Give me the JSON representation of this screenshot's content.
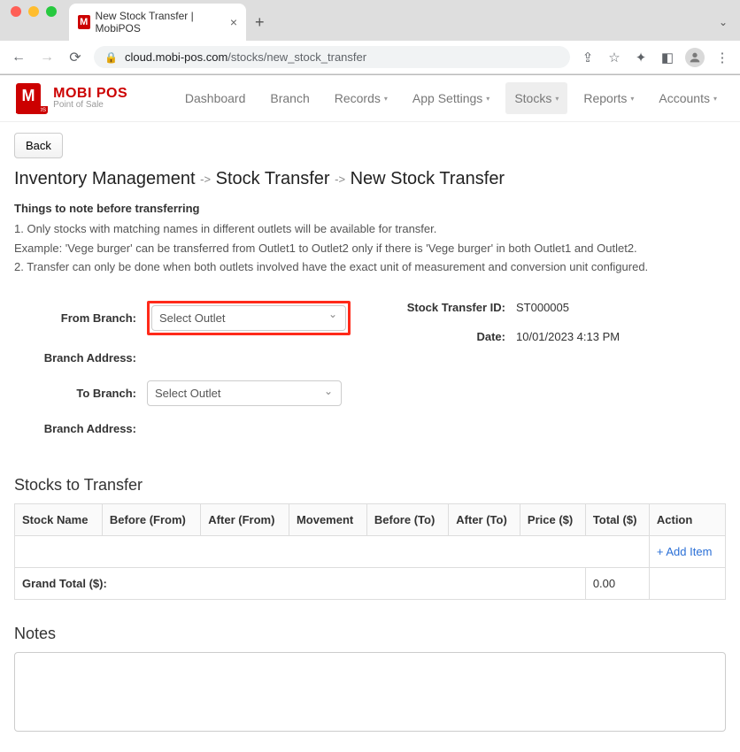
{
  "browser": {
    "tab_title": "New Stock Transfer | MobiPOS",
    "url_host": "cloud.mobi-pos.com",
    "url_path": "/stocks/new_stock_transfer"
  },
  "brand": {
    "logo_letter": "M",
    "logo_sub": "MOBI POS",
    "name": "MOBI POS",
    "tagline": "Point of Sale"
  },
  "nav": {
    "dashboard": "Dashboard",
    "branch": "Branch",
    "records": "Records",
    "app_settings": "App Settings",
    "stocks": "Stocks",
    "reports": "Reports",
    "accounts": "Accounts"
  },
  "back_label": "Back",
  "breadcrumb": {
    "a": "Inventory Management",
    "b": "Stock Transfer",
    "c": "New Stock Transfer"
  },
  "notes": {
    "heading": "Things to note before transferring",
    "n1": "1. Only stocks with matching names in different outlets will be available for transfer.",
    "n1b": "Example: 'Vege burger' can be transferred from Outlet1 to Outlet2 only if there is 'Vege burger' in both Outlet1 and Outlet2.",
    "n2": "2. Transfer can only be done when both outlets involved have the exact unit of measurement and conversion unit configured."
  },
  "labels": {
    "from_branch": "From Branch:",
    "branch_address": "Branch Address:",
    "to_branch": "To Branch:",
    "transfer_id": "Stock Transfer ID:",
    "date": "Date:",
    "select_outlet": "Select Outlet"
  },
  "info": {
    "transfer_id": "ST000005",
    "date": "10/01/2023 4:13 PM"
  },
  "stocks": {
    "heading": "Stocks to Transfer",
    "cols": {
      "name": "Stock Name",
      "bf": "Before (From)",
      "af": "After (From)",
      "mv": "Movement",
      "bt": "Before (To)",
      "at": "After (To)",
      "price": "Price ($)",
      "total": "Total ($)",
      "action": "Action"
    },
    "add_item": "Add Item",
    "grand_total_label": "Grand Total ($):",
    "grand_total": "0.00"
  },
  "notes_section": {
    "heading": "Notes"
  }
}
